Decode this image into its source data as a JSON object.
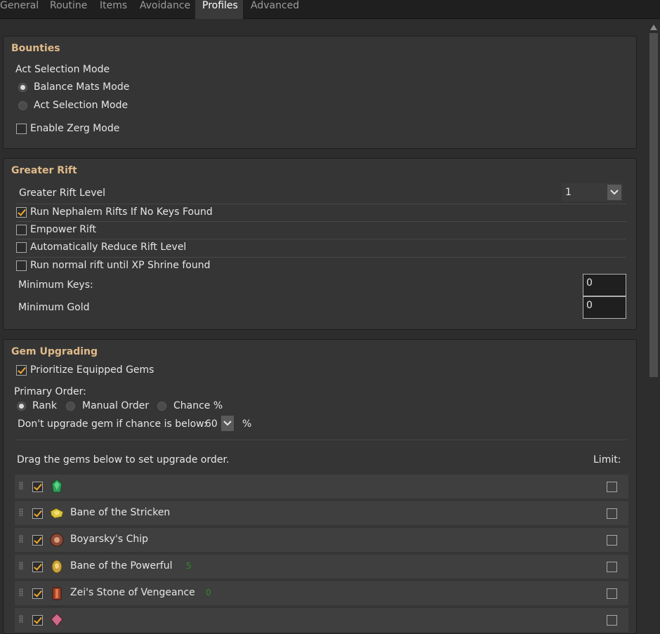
{
  "tabs": [
    "General",
    "Routine",
    "Items",
    "Avoidance",
    "Profiles",
    "Advanced"
  ],
  "active_tab": "Profiles",
  "bounties": {
    "title": "Bounties",
    "mode_label": "Act Selection Mode",
    "radio_balance": "Balance Mats Mode",
    "radio_act": "Act Selection Mode",
    "zerg_label": "Enable Zerg Mode"
  },
  "greater_rift": {
    "title": "Greater Rift",
    "level_label": "Greater Rift Level",
    "level_value": "1",
    "run_nephalem": "Run Nephalem Rifts If No Keys Found",
    "empower": "Empower Rift",
    "auto_reduce": "Automatically Reduce Rift Level",
    "xp_shrine": "Run normal rift until XP Shrine found",
    "min_keys_label": "Minimum Keys:",
    "min_keys_value": "0",
    "min_gold_label": "Minimum Gold",
    "min_gold_value": "0"
  },
  "gem_upgrading": {
    "title": "Gem Upgrading",
    "prioritize": "Prioritize Equipped Gems",
    "primary_order": "Primary Order:",
    "order_rank": "Rank",
    "order_manual": "Manual Order",
    "order_chance": "Chance %",
    "chance_label": "Don't upgrade gem if chance is below:",
    "chance_value": "60",
    "chance_unit": "%",
    "drag_hint": "Drag the gems below to set upgrade order.",
    "limit_label": "Limit:",
    "gems": [
      {
        "name": "",
        "level": "",
        "icon": "green-gem-icon",
        "color": "#2f9e55"
      },
      {
        "name": "Bane of the Stricken",
        "level": "",
        "icon": "bane-of-the-stricken-gem-icon",
        "color": "#d8c43a"
      },
      {
        "name": "Boyarsky's Chip",
        "level": "",
        "icon": "boyarskys-chip-gem-icon",
        "color": "#8a4a3a"
      },
      {
        "name": "Bane of the Powerful",
        "level": "5",
        "icon": "bane-of-the-powerful-gem-icon",
        "color": "#c9a23e"
      },
      {
        "name": "Zei's Stone of Vengeance",
        "level": "0",
        "icon": "zeis-stone-gem-icon",
        "color": "#a0402a"
      },
      {
        "name": "",
        "level": "",
        "icon": "pink-gem-icon",
        "color": "#d06a8a"
      }
    ]
  },
  "colors": {
    "accent_title": "#e0ba8a",
    "check_mark": "#f0a830",
    "gem_level": "#2e8b2e"
  }
}
